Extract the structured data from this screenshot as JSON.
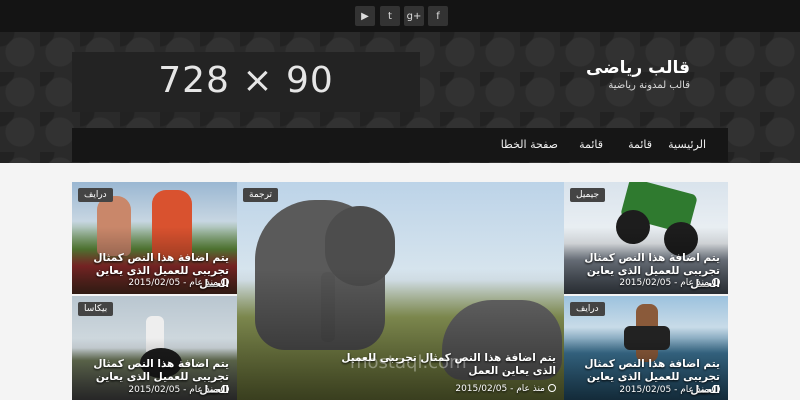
{
  "social": [
    {
      "icon": "youtube-icon",
      "glyph": "▶"
    },
    {
      "icon": "twitter-icon",
      "glyph": "t"
    },
    {
      "icon": "google-plus-icon",
      "glyph": "g+"
    },
    {
      "icon": "facebook-icon",
      "glyph": "f"
    }
  ],
  "ad": {
    "text": "728 × 90"
  },
  "brand": {
    "title": "قالب رياضى",
    "subtitle": "قالب لمدونة رياضية"
  },
  "nav": {
    "items": [
      "الرئيسية",
      "قائمة",
      "قائمة",
      "صفحة الخطا"
    ]
  },
  "posts": {
    "top_left": {
      "badge": "درايف",
      "caption": "يتم اضافة هذا النص كمثال تجريبى للعميل الذى يعاين العمل",
      "meta": "منذ عام - 2015/02/05"
    },
    "bottom_left": {
      "badge": "بيكاسا",
      "caption": "يتم اضافة هذا النص كمثال تجريبى للعميل الذى يعاين العمل",
      "meta": "منذ عام - 2015/02/05"
    },
    "center": {
      "badge": "ترجمة",
      "caption": "يتم اضافة هذا النص كمثال تجريبى للعميل الذى يعاين العمل",
      "meta": "منذ عام - 2015/02/05"
    },
    "top_right": {
      "badge": "جيميل",
      "caption": "يتم اضافة هذا النص كمثال تجريبى للعميل الذى يعاين العمل",
      "meta": "منذ عام - 2015/02/05"
    },
    "bottom_right": {
      "badge": "درايف",
      "caption": "يتم اضافة هذا النص كمثال تجريبى للعميل الذى يعاين العمل",
      "meta": "منذ عام - 2015/02/05"
    }
  },
  "watermark": "mostaql.com"
}
